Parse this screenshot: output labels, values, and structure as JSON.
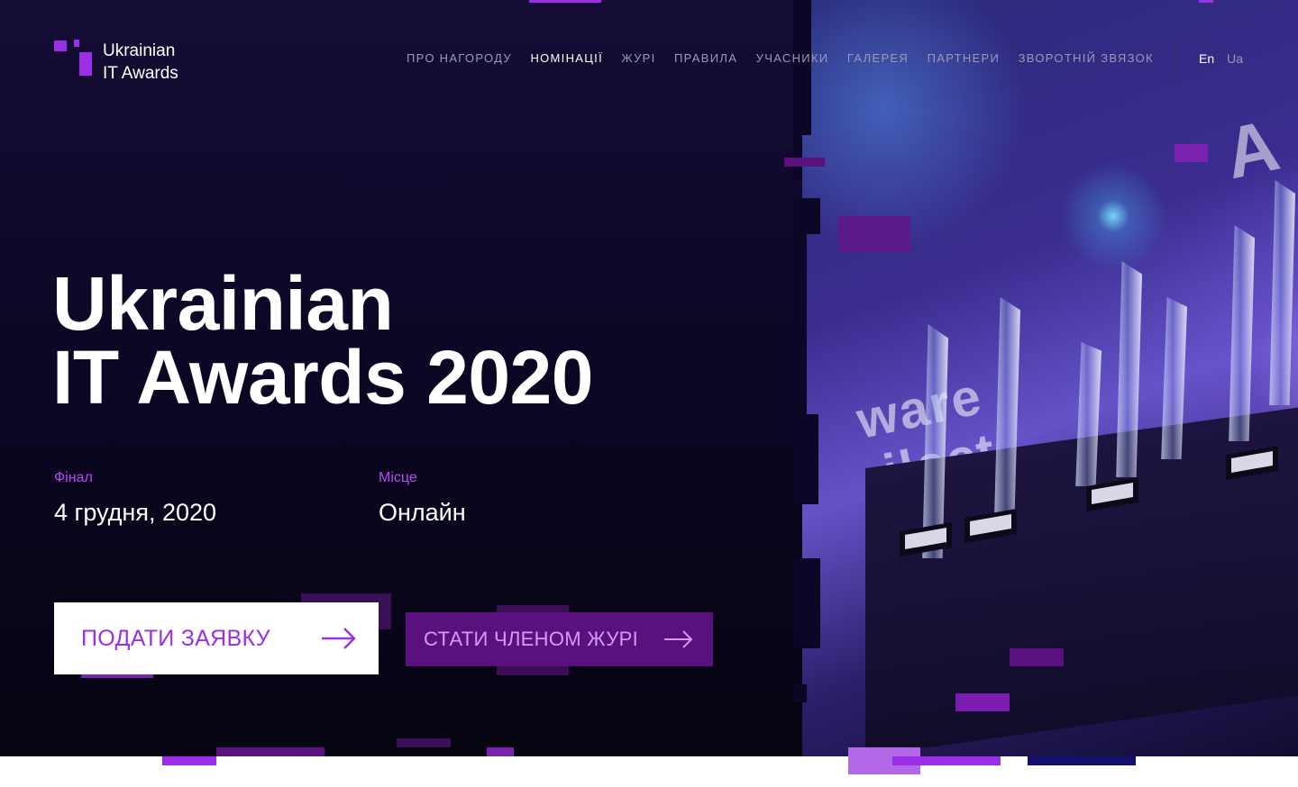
{
  "header": {
    "logo_line1": "Ukrainian",
    "logo_line2": "IT Awards",
    "nav": [
      {
        "label": "Про нагороду",
        "active": false
      },
      {
        "label": "Номінації",
        "active": true
      },
      {
        "label": "Журі",
        "active": false
      },
      {
        "label": "Правила",
        "active": false
      },
      {
        "label": "Учасники",
        "active": false
      },
      {
        "label": "Галерея",
        "active": false
      },
      {
        "label": "Партнери",
        "active": false
      },
      {
        "label": "Зворотній звязок",
        "active": false
      }
    ],
    "languages": [
      {
        "label": "En",
        "active": true
      },
      {
        "label": "Ua",
        "active": false
      }
    ]
  },
  "hero": {
    "title_line1": "Ukrainian",
    "title_line2": "IT Awards 2020",
    "final_label": "Фінал",
    "final_value": "4 грудня, 2020",
    "place_label": "Місце",
    "place_value": "Онлайн",
    "primary_button": "ПОДАТИ ЗАЯВКУ",
    "secondary_button": "СТАТИ ЧЛЕНОМ ЖУРІ"
  },
  "colors": {
    "accent": "#9b2fe6",
    "background": "#0b0622",
    "secondary_button_bg": "#5a117e"
  }
}
